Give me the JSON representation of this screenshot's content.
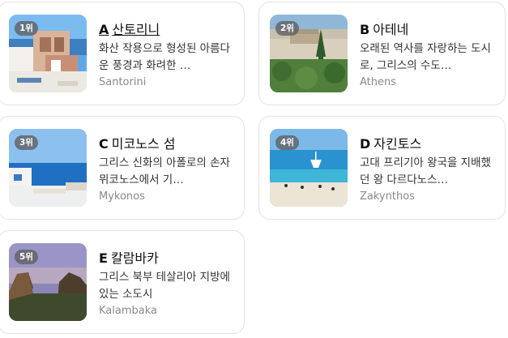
{
  "places": [
    {
      "rank": "1위",
      "letter": "A",
      "name": "산토리니",
      "desc": "화산 작용으로 형성된 아름다운 풍경과 화려한 …",
      "en": "Santorini"
    },
    {
      "rank": "2위",
      "letter": "B",
      "name": "아테네",
      "desc": "오래된 역사를 자랑하는 도시로, 그리스의 수도…",
      "en": "Athens"
    },
    {
      "rank": "3위",
      "letter": "C",
      "name": "미코노스 섬",
      "desc": "그리스 신화의 아폴로의 손자 뮈코노스에서 기…",
      "en": "Mykonos"
    },
    {
      "rank": "4위",
      "letter": "D",
      "name": "자킨토스",
      "desc": "고대 프리기아 왕국을 지배했던 왕 다르다노스…",
      "en": "Zakynthos"
    },
    {
      "rank": "5위",
      "letter": "E",
      "name": "칼람바카",
      "desc": "그리스 북부 테살리아 지방에 있는 소도시",
      "en": "Kalambaka"
    }
  ]
}
